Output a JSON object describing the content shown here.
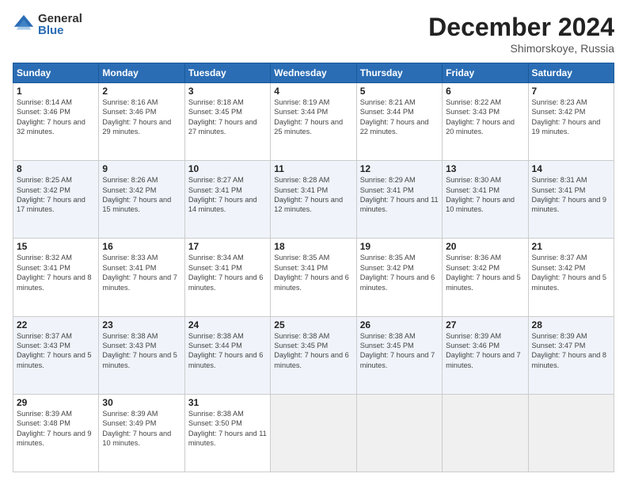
{
  "logo": {
    "general": "General",
    "blue": "Blue"
  },
  "header": {
    "month": "December 2024",
    "location": "Shimorskoye, Russia"
  },
  "days_of_week": [
    "Sunday",
    "Monday",
    "Tuesday",
    "Wednesday",
    "Thursday",
    "Friday",
    "Saturday"
  ],
  "weeks": [
    [
      {
        "day": "1",
        "sunrise": "Sunrise: 8:14 AM",
        "sunset": "Sunset: 3:46 PM",
        "daylight": "Daylight: 7 hours and 32 minutes."
      },
      {
        "day": "2",
        "sunrise": "Sunrise: 8:16 AM",
        "sunset": "Sunset: 3:46 PM",
        "daylight": "Daylight: 7 hours and 29 minutes."
      },
      {
        "day": "3",
        "sunrise": "Sunrise: 8:18 AM",
        "sunset": "Sunset: 3:45 PM",
        "daylight": "Daylight: 7 hours and 27 minutes."
      },
      {
        "day": "4",
        "sunrise": "Sunrise: 8:19 AM",
        "sunset": "Sunset: 3:44 PM",
        "daylight": "Daylight: 7 hours and 25 minutes."
      },
      {
        "day": "5",
        "sunrise": "Sunrise: 8:21 AM",
        "sunset": "Sunset: 3:44 PM",
        "daylight": "Daylight: 7 hours and 22 minutes."
      },
      {
        "day": "6",
        "sunrise": "Sunrise: 8:22 AM",
        "sunset": "Sunset: 3:43 PM",
        "daylight": "Daylight: 7 hours and 20 minutes."
      },
      {
        "day": "7",
        "sunrise": "Sunrise: 8:23 AM",
        "sunset": "Sunset: 3:42 PM",
        "daylight": "Daylight: 7 hours and 19 minutes."
      }
    ],
    [
      {
        "day": "8",
        "sunrise": "Sunrise: 8:25 AM",
        "sunset": "Sunset: 3:42 PM",
        "daylight": "Daylight: 7 hours and 17 minutes."
      },
      {
        "day": "9",
        "sunrise": "Sunrise: 8:26 AM",
        "sunset": "Sunset: 3:42 PM",
        "daylight": "Daylight: 7 hours and 15 minutes."
      },
      {
        "day": "10",
        "sunrise": "Sunrise: 8:27 AM",
        "sunset": "Sunset: 3:41 PM",
        "daylight": "Daylight: 7 hours and 14 minutes."
      },
      {
        "day": "11",
        "sunrise": "Sunrise: 8:28 AM",
        "sunset": "Sunset: 3:41 PM",
        "daylight": "Daylight: 7 hours and 12 minutes."
      },
      {
        "day": "12",
        "sunrise": "Sunrise: 8:29 AM",
        "sunset": "Sunset: 3:41 PM",
        "daylight": "Daylight: 7 hours and 11 minutes."
      },
      {
        "day": "13",
        "sunrise": "Sunrise: 8:30 AM",
        "sunset": "Sunset: 3:41 PM",
        "daylight": "Daylight: 7 hours and 10 minutes."
      },
      {
        "day": "14",
        "sunrise": "Sunrise: 8:31 AM",
        "sunset": "Sunset: 3:41 PM",
        "daylight": "Daylight: 7 hours and 9 minutes."
      }
    ],
    [
      {
        "day": "15",
        "sunrise": "Sunrise: 8:32 AM",
        "sunset": "Sunset: 3:41 PM",
        "daylight": "Daylight: 7 hours and 8 minutes."
      },
      {
        "day": "16",
        "sunrise": "Sunrise: 8:33 AM",
        "sunset": "Sunset: 3:41 PM",
        "daylight": "Daylight: 7 hours and 7 minutes."
      },
      {
        "day": "17",
        "sunrise": "Sunrise: 8:34 AM",
        "sunset": "Sunset: 3:41 PM",
        "daylight": "Daylight: 7 hours and 6 minutes."
      },
      {
        "day": "18",
        "sunrise": "Sunrise: 8:35 AM",
        "sunset": "Sunset: 3:41 PM",
        "daylight": "Daylight: 7 hours and 6 minutes."
      },
      {
        "day": "19",
        "sunrise": "Sunrise: 8:35 AM",
        "sunset": "Sunset: 3:42 PM",
        "daylight": "Daylight: 7 hours and 6 minutes."
      },
      {
        "day": "20",
        "sunrise": "Sunrise: 8:36 AM",
        "sunset": "Sunset: 3:42 PM",
        "daylight": "Daylight: 7 hours and 5 minutes."
      },
      {
        "day": "21",
        "sunrise": "Sunrise: 8:37 AM",
        "sunset": "Sunset: 3:42 PM",
        "daylight": "Daylight: 7 hours and 5 minutes."
      }
    ],
    [
      {
        "day": "22",
        "sunrise": "Sunrise: 8:37 AM",
        "sunset": "Sunset: 3:43 PM",
        "daylight": "Daylight: 7 hours and 5 minutes."
      },
      {
        "day": "23",
        "sunrise": "Sunrise: 8:38 AM",
        "sunset": "Sunset: 3:43 PM",
        "daylight": "Daylight: 7 hours and 5 minutes."
      },
      {
        "day": "24",
        "sunrise": "Sunrise: 8:38 AM",
        "sunset": "Sunset: 3:44 PM",
        "daylight": "Daylight: 7 hours and 6 minutes."
      },
      {
        "day": "25",
        "sunrise": "Sunrise: 8:38 AM",
        "sunset": "Sunset: 3:45 PM",
        "daylight": "Daylight: 7 hours and 6 minutes."
      },
      {
        "day": "26",
        "sunrise": "Sunrise: 8:38 AM",
        "sunset": "Sunset: 3:45 PM",
        "daylight": "Daylight: 7 hours and 7 minutes."
      },
      {
        "day": "27",
        "sunrise": "Sunrise: 8:39 AM",
        "sunset": "Sunset: 3:46 PM",
        "daylight": "Daylight: 7 hours and 7 minutes."
      },
      {
        "day": "28",
        "sunrise": "Sunrise: 8:39 AM",
        "sunset": "Sunset: 3:47 PM",
        "daylight": "Daylight: 7 hours and 8 minutes."
      }
    ],
    [
      {
        "day": "29",
        "sunrise": "Sunrise: 8:39 AM",
        "sunset": "Sunset: 3:48 PM",
        "daylight": "Daylight: 7 hours and 9 minutes."
      },
      {
        "day": "30",
        "sunrise": "Sunrise: 8:39 AM",
        "sunset": "Sunset: 3:49 PM",
        "daylight": "Daylight: 7 hours and 10 minutes."
      },
      {
        "day": "31",
        "sunrise": "Sunrise: 8:38 AM",
        "sunset": "Sunset: 3:50 PM",
        "daylight": "Daylight: 7 hours and 11 minutes."
      },
      null,
      null,
      null,
      null
    ]
  ]
}
